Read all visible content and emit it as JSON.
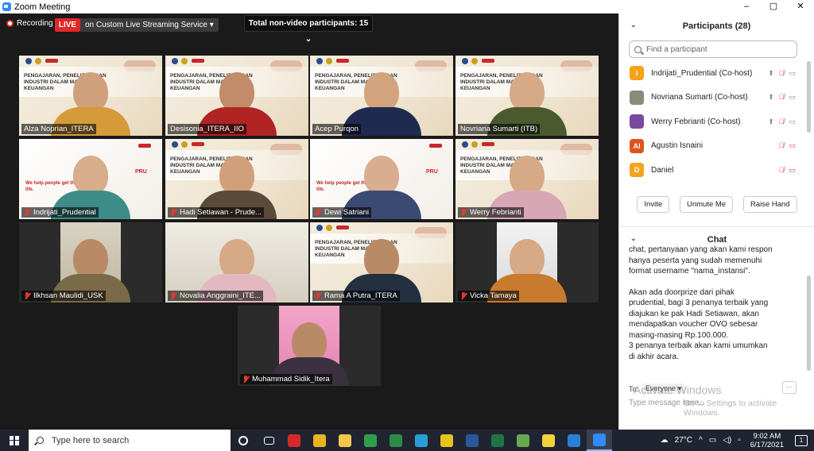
{
  "window": {
    "title": "Zoom Meeting",
    "buttons": [
      "–",
      "▢",
      "✕"
    ]
  },
  "video_top": {
    "recording_label": "Recording",
    "live_label": "LIVE",
    "stream_label": "on Custom Live Streaming Service",
    "stream_caret": "▾",
    "non_video": "Total non-video participants: 15",
    "non_video_caret": "⌄"
  },
  "tiles": [
    {
      "name": "Alza Noprian_ITERA",
      "muted": false,
      "kind": "slide",
      "shirt": "#d59a3a",
      "skin": "#d0a07d"
    },
    {
      "name": "Desisonia_ITERA_IIO",
      "muted": false,
      "kind": "slide",
      "shirt": "#b02424",
      "skin": "#c28b6a"
    },
    {
      "name": "Acep Purqon",
      "muted": false,
      "kind": "slide",
      "shirt": "#1e2a50",
      "skin": "#d2a37d"
    },
    {
      "name": "Novriana Sumarti (ITB)",
      "muted": false,
      "kind": "slide",
      "shirt": "#4a5a2e",
      "skin": "#d6a987"
    },
    {
      "name": "Indrijati_Prudential",
      "muted": true,
      "kind": "prudential",
      "shirt": "#3d8c8a",
      "skin": "#d7ad8a"
    },
    {
      "name": "Hadi Setiawan - Prude...",
      "muted": true,
      "kind": "slide",
      "shirt": "#5a4a3a",
      "skin": "#d1a07a"
    },
    {
      "name": "Dewi Satriani",
      "muted": true,
      "kind": "prudential",
      "shirt": "#3b4a72",
      "skin": "#d9ae90"
    },
    {
      "name": "Werry Febrianti",
      "muted": true,
      "kind": "slide",
      "shirt": "#d8a7b6",
      "skin": "#d6a987"
    },
    {
      "name": "Ilkhsan Maulidi_USK",
      "muted": true,
      "kind": "room-small",
      "shirt": "#7a6a48",
      "skin": "#b98a66"
    },
    {
      "name": "Novalia Anggraini_ITE...",
      "muted": true,
      "kind": "room",
      "shirt": "#e3b8c0",
      "skin": "#d6a987"
    },
    {
      "name": "Rama A Putra_ITERA",
      "muted": true,
      "kind": "slide",
      "shirt": "#223040",
      "skin": "#b98a66"
    },
    {
      "name": "Vicka Tamaya",
      "muted": true,
      "kind": "room-small-light",
      "shirt": "#c87a2e",
      "skin": "#d6a987"
    },
    {
      "name": "Muhammad Sidik_Itera",
      "muted": true,
      "kind": "room-pink",
      "shirt": "#3a3040",
      "skin": "#b98a66"
    }
  ],
  "slide_text": "PENGAJARAN, PENELITIAN DAN INDUSTRI DALAM MATEMATIKA KEUANGAN",
  "prudential_text": "PRU",
  "participants": {
    "title": "Participants (28)",
    "search_placeholder": "Find a participant",
    "list": [
      {
        "initials": "I",
        "color": "#f5a31a",
        "name": "Indrijati_Prudential (Co-host)",
        "share": true,
        "cam_on": true
      },
      {
        "initials": "",
        "color": "#8a8a7a",
        "name": "Novriana Sumarti  (Co-host)",
        "share": true,
        "cam_on": true
      },
      {
        "initials": "",
        "color": "#7a4aa0",
        "name": "Werry Febrianti (Co-host)",
        "share": true,
        "cam_on": true
      },
      {
        "initials": "AI",
        "color": "#e0541c",
        "name": "Agustin Isnaini",
        "share": false,
        "cam_on": false
      },
      {
        "initials": "D",
        "color": "#f5a31a",
        "name": "Daniel",
        "share": false,
        "cam_on": false
      }
    ],
    "buttons": [
      "Invite",
      "Unmute Me",
      "Raise Hand"
    ]
  },
  "chat": {
    "title": "Chat",
    "messages": [
      "chat, pertanyaan yang akan kami respon\nhanya peserta yang sudah memenuhi\nformat username \"nama_instansi\".",
      "Akan ada doorprize dari pihak\nprudential, bagi 3 penanya terbaik yang\ndiajukan ke pak Hadi Setiawan, akan\nmendapatkan voucher OVO sebesar\nmasing-masing Rp.100.000.\n3 penanya terbaik akan kami umumkan\ndi akhir acara."
    ],
    "to_label": "To:",
    "to_value": "Everyone",
    "more": "···",
    "input_placeholder": "Type message here..."
  },
  "watermark": {
    "title": "Activate Windows",
    "sub": "Go to Settings to activate Windows."
  },
  "taskbar": {
    "search_placeholder": "Type here to search",
    "apps": [
      {
        "name": "cortana-icon",
        "color": "#ffffff"
      },
      {
        "name": "task-view-icon",
        "color": "#ffffff"
      },
      {
        "name": "acrobat-icon",
        "color": "#d42a2a"
      },
      {
        "name": "chrome-icon",
        "color": "#e8b521"
      },
      {
        "name": "file-explorer-icon",
        "color": "#f3c74a"
      },
      {
        "name": "sheets-icon",
        "color": "#2ea04a"
      },
      {
        "name": "forward-icon",
        "color": "#2c8c46"
      },
      {
        "name": "edge-icon",
        "color": "#2a9fd6"
      },
      {
        "name": "media-icon",
        "color": "#e7c21a"
      },
      {
        "name": "word-icon",
        "color": "#2b579a"
      },
      {
        "name": "excel-icon",
        "color": "#217346"
      },
      {
        "name": "paint-icon",
        "color": "#6aa84f"
      },
      {
        "name": "sticky-icon",
        "color": "#f3d23a"
      },
      {
        "name": "photos-icon",
        "color": "#2a7fd6"
      },
      {
        "name": "zoom-icon",
        "color": "#2D8CFF"
      }
    ],
    "weather": "27°C",
    "time": "9:02 AM",
    "date": "6/17/2021",
    "notif_count": "1"
  }
}
